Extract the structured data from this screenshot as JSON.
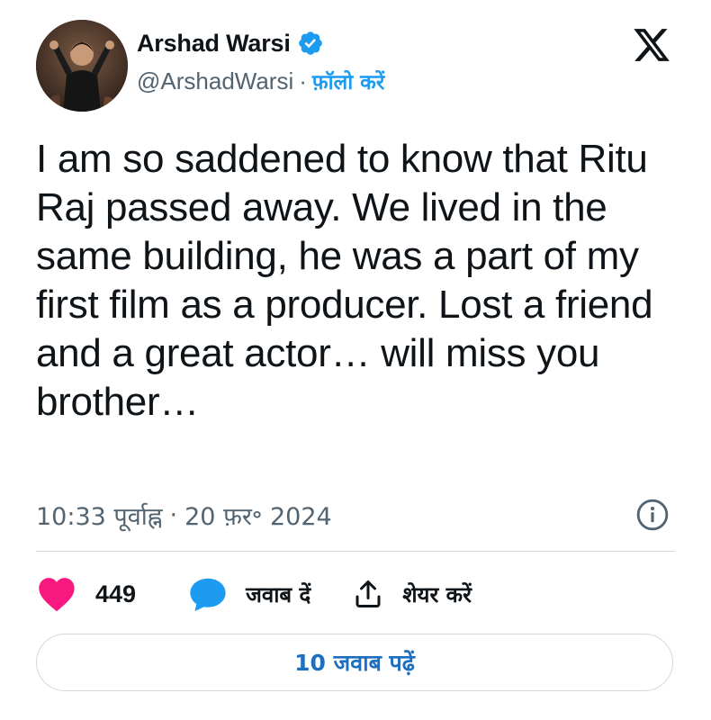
{
  "author": {
    "display_name": "Arshad Warsi",
    "handle": "@ArshadWarsi",
    "separator": "·",
    "follow_label": "फ़ॉलो करें",
    "verified": true
  },
  "tweet": {
    "text": "I am so saddened to know that Ritu Raj passed away. We lived in the same building, he was a part of my first film as a producer. Lost a friend and a great actor… will miss you brother…",
    "time": "10:33 पूर्वाह्न",
    "date_separator": "·",
    "date": "20 फ़र॰ 2024"
  },
  "actions": {
    "like_count": "449",
    "reply_label": "जवाब दें",
    "share_label": "शेयर करें"
  },
  "read_replies_label": "10 जवाब पढ़ें",
  "icons": {
    "logo": "x-logo-icon",
    "verified": "verified-badge-icon",
    "info": "info-icon",
    "like": "heart-icon",
    "reply": "speech-bubble-icon",
    "share": "share-upload-icon"
  },
  "colors": {
    "accent": "#1d9bf0",
    "heart": "#f91880",
    "text": "#0f1419",
    "muted": "#536471",
    "border": "#cfd9de"
  }
}
